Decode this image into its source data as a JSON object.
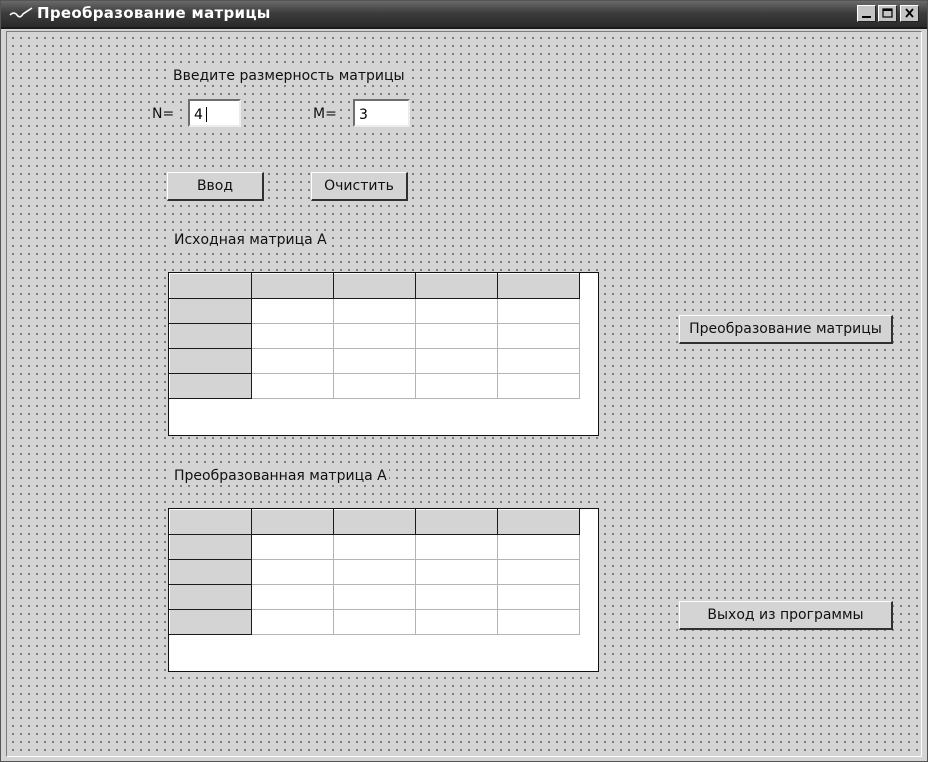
{
  "window": {
    "title": "Преобразование матрицы",
    "controls": [
      "minimize",
      "maximize",
      "close"
    ]
  },
  "form": {
    "prompt": "Введите размерность матрицы",
    "n_label": "N=",
    "n_value": "4",
    "m_label": "M=",
    "m_value": "3",
    "enter_button": "Ввод",
    "clear_button": "Очистить",
    "source_label": "Исходная матрица А",
    "result_label": "Преобразованная матрица А",
    "transform_button": "Преобразование матрицы",
    "exit_button": "Выход из программы"
  },
  "source_grid": {
    "columns": 5,
    "rows": 5,
    "cells": [
      [
        "",
        "",
        "",
        "",
        ""
      ],
      [
        "",
        "",
        "",
        "",
        ""
      ],
      [
        "",
        "",
        "",
        "",
        ""
      ],
      [
        "",
        "",
        "",
        "",
        ""
      ],
      [
        "",
        "",
        "",
        "",
        ""
      ]
    ]
  },
  "result_grid": {
    "columns": 5,
    "rows": 5,
    "cells": [
      [
        "",
        "",
        "",
        "",
        ""
      ],
      [
        "",
        "",
        "",
        "",
        ""
      ],
      [
        "",
        "",
        "",
        "",
        ""
      ],
      [
        "",
        "",
        "",
        "",
        ""
      ],
      [
        "",
        "",
        "",
        "",
        ""
      ]
    ]
  },
  "colors": {
    "titlebar": "#3d3d3d",
    "form_background": "#d4d4d4",
    "grid_fixed_cells": "#d4d4d4",
    "grid_cells": "#ffffff"
  },
  "icons": [
    "window-menu-icon",
    "minimize-icon",
    "maximize-icon",
    "close-icon"
  ]
}
